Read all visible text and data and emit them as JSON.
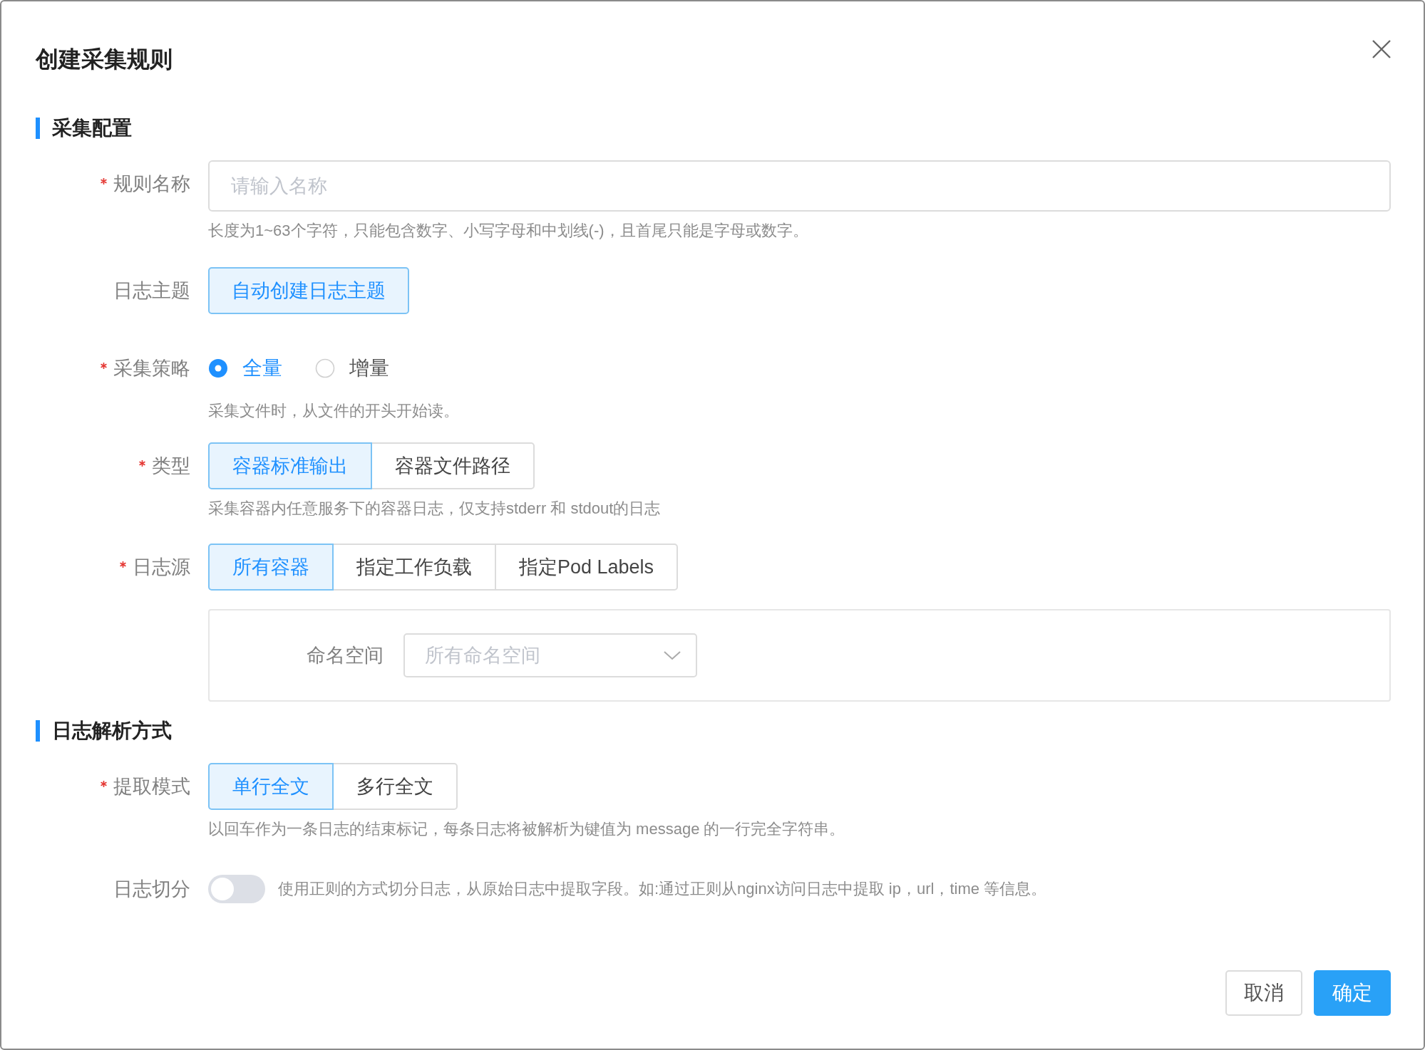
{
  "dialog": {
    "title": "创建采集规则"
  },
  "sections": [
    {
      "title": "采集配置",
      "fields": [
        {
          "kind": "text",
          "label": "规则名称",
          "required": true,
          "placeholder": "请输入名称",
          "hint": "长度为1~63个字符，只能包含数字、小写字母和中划线(-)，且首尾只能是字母或数字。"
        },
        {
          "kind": "button",
          "label": "日志主题",
          "required": false,
          "button": "自动创建日志主题"
        },
        {
          "kind": "radio",
          "label": "采集策略",
          "required": true,
          "options": [
            {
              "label": "全量",
              "selected": true
            },
            {
              "label": "增量",
              "selected": false
            }
          ],
          "hint": "采集文件时，从文件的开头开始读。"
        },
        {
          "kind": "segmented",
          "label": "类型",
          "required": true,
          "options": [
            {
              "label": "容器标准输出",
              "selected": true
            },
            {
              "label": "容器文件路径",
              "selected": false
            }
          ],
          "hint": "采集容器内任意服务下的容器日志，仅支持stderr 和 stdout的日志"
        },
        {
          "kind": "segmented",
          "label": "日志源",
          "required": true,
          "options": [
            {
              "label": "所有容器",
              "selected": true
            },
            {
              "label": "指定工作负载",
              "selected": false
            },
            {
              "label": "指定Pod Labels",
              "selected": false
            }
          ],
          "panel": {
            "label": "命名空间",
            "placeholder": "所有命名空间"
          }
        }
      ]
    },
    {
      "title": "日志解析方式",
      "fields": [
        {
          "kind": "segmented",
          "label": "提取模式",
          "required": true,
          "options": [
            {
              "label": "单行全文",
              "selected": true
            },
            {
              "label": "多行全文",
              "selected": false
            }
          ],
          "hint": "以回车作为一条日志的结束标记，每条日志将被解析为键值为 message 的一行完全字符串。"
        },
        {
          "kind": "switch",
          "label": "日志切分",
          "required": false,
          "on": false,
          "description": "使用正则的方式切分日志，从原始日志中提取字段。如:通过正则从nginx访问日志中提取 ip，url，time 等信息。"
        }
      ]
    }
  ],
  "footer": {
    "buttons": [
      {
        "label": "取消",
        "kind": "default"
      },
      {
        "label": "确定",
        "kind": "primary"
      }
    ]
  }
}
